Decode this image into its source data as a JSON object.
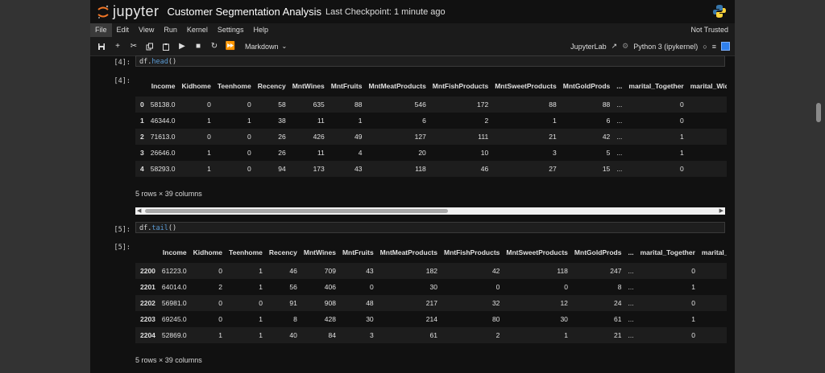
{
  "app": {
    "logo_text": "jupyter",
    "notebook_title": "Customer Segmentation Analysis",
    "checkpoint": "Last Checkpoint: 1 minute ago",
    "trusted": "Not Trusted"
  },
  "menu": [
    "File",
    "Edit",
    "View",
    "Run",
    "Kernel",
    "Settings",
    "Help"
  ],
  "toolbar": {
    "icons": [
      "save-icon",
      "add-icon",
      "cut-icon",
      "copy-icon",
      "paste-icon",
      "run-icon",
      "stop-icon",
      "restart-icon",
      "fast-forward-icon"
    ],
    "cell_type": "Markdown",
    "jupyterlab_label": "JupyterLab",
    "kernel": "Python 3 (ipykernel)"
  },
  "cells": [
    {
      "in_prompt": "[4]:",
      "code_var": "df.",
      "code_fn": "head",
      "code_tail": "()",
      "out_prompt": "[4]:",
      "columns": [
        "",
        "Income",
        "Kidhome",
        "Teenhome",
        "Recency",
        "MntWines",
        "MntFruits",
        "MntMeatProducts",
        "MntFishProducts",
        "MntSweetProducts",
        "MntGoldProds",
        "...",
        "marital_Together",
        "marital_Widow"
      ],
      "rows": [
        [
          "0",
          "58138.0",
          "0",
          "0",
          "58",
          "635",
          "88",
          "546",
          "172",
          "88",
          "88",
          "...",
          "0"
        ],
        [
          "1",
          "46344.0",
          "1",
          "1",
          "38",
          "11",
          "1",
          "6",
          "2",
          "1",
          "6",
          "...",
          "0"
        ],
        [
          "2",
          "71613.0",
          "0",
          "0",
          "26",
          "426",
          "49",
          "127",
          "111",
          "21",
          "42",
          "...",
          "1"
        ],
        [
          "3",
          "26646.0",
          "1",
          "0",
          "26",
          "11",
          "4",
          "20",
          "10",
          "3",
          "5",
          "...",
          "1"
        ],
        [
          "4",
          "58293.0",
          "1",
          "0",
          "94",
          "173",
          "43",
          "118",
          "46",
          "27",
          "15",
          "...",
          "0"
        ]
      ],
      "dims": "5 rows × 39 columns"
    },
    {
      "in_prompt": "[5]:",
      "code_var": "df.",
      "code_fn": "tail",
      "code_tail": "()",
      "out_prompt": "[5]:",
      "columns": [
        "",
        "Income",
        "Kidhome",
        "Teenhome",
        "Recency",
        "MntWines",
        "MntFruits",
        "MntMeatProducts",
        "MntFishProducts",
        "MntSweetProducts",
        "MntGoldProds",
        "...",
        "marital_Together",
        "marital_Widow"
      ],
      "rows": [
        [
          "2200",
          "61223.0",
          "0",
          "1",
          "46",
          "709",
          "43",
          "182",
          "42",
          "118",
          "247",
          "...",
          "0"
        ],
        [
          "2201",
          "64014.0",
          "2",
          "1",
          "56",
          "406",
          "0",
          "30",
          "0",
          "0",
          "8",
          "...",
          "1"
        ],
        [
          "2202",
          "56981.0",
          "0",
          "0",
          "91",
          "908",
          "48",
          "217",
          "32",
          "12",
          "24",
          "...",
          "0"
        ],
        [
          "2203",
          "69245.0",
          "0",
          "1",
          "8",
          "428",
          "30",
          "214",
          "80",
          "30",
          "61",
          "...",
          "1"
        ],
        [
          "2204",
          "52869.0",
          "1",
          "1",
          "40",
          "84",
          "3",
          "61",
          "2",
          "1",
          "21",
          "...",
          "0"
        ]
      ],
      "dims": "5 rows × 39 columns"
    }
  ]
}
